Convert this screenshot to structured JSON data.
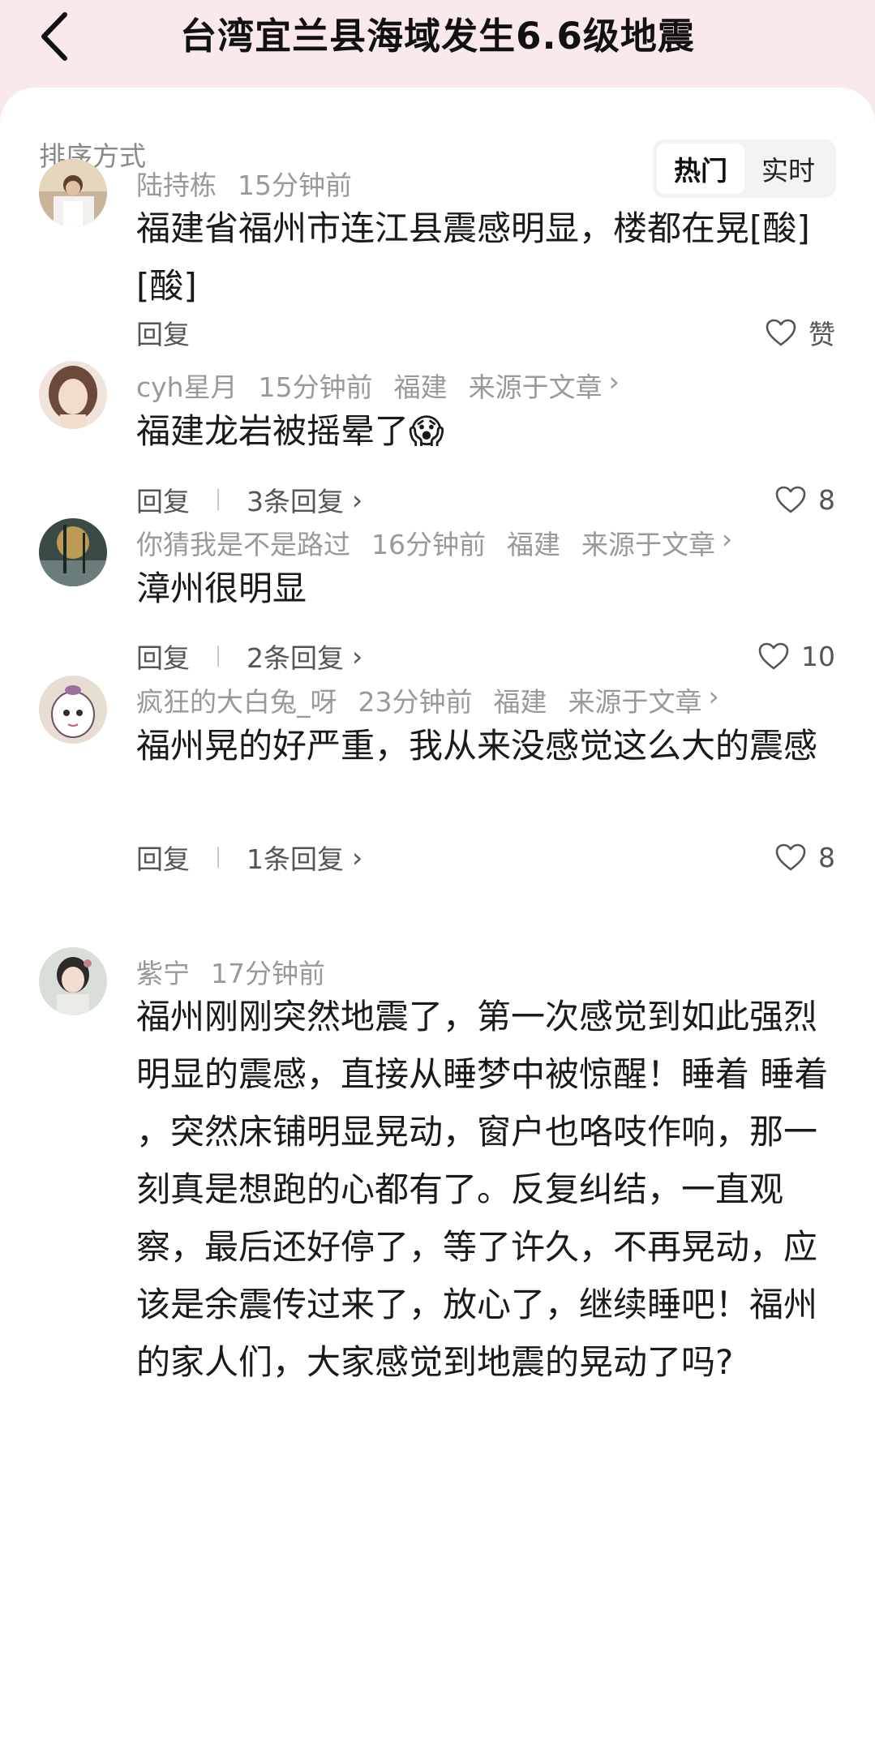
{
  "header": {
    "title": "台湾宜兰县海域发生6.6级地震"
  },
  "sort": {
    "label": "排序方式",
    "options": [
      "热门",
      "实时"
    ],
    "selected": "热门"
  },
  "comments": [
    {
      "user": "陆持栋",
      "time": "15分钟前",
      "location": "",
      "source": "",
      "text": "福建省福州市连江县震感明显，楼都在晃[酸][酸]",
      "reply_label": "回复",
      "reply_count": "",
      "likes": "赞"
    },
    {
      "user": "cyh星月",
      "time": "15分钟前",
      "location": "福建",
      "source": "来源于文章",
      "text": "福建龙岩被摇晕了😱",
      "reply_label": "回复",
      "reply_count": "3条回复",
      "likes": "8"
    },
    {
      "user": "你猜我是不是路过",
      "time": "16分钟前",
      "location": "福建",
      "source": "来源于文章",
      "text": "漳州很明显",
      "reply_label": "回复",
      "reply_count": "2条回复",
      "likes": "10"
    },
    {
      "user": "疯狂的大白兔_呀",
      "time": "23分钟前",
      "location": "福建",
      "source": "来源于文章",
      "text": "福州晃的好严重，我从来没感觉这么大的震感",
      "reply_label": "回复",
      "reply_count": "1条回复",
      "likes": "8"
    },
    {
      "user": "紫宁",
      "time": "17分钟前",
      "location": "",
      "source": "",
      "text": "福州刚刚突然地震了，第一次感觉到如此强烈明显的震感，直接从睡梦中被惊醒！睡着 睡着 ，突然床铺明显晃动，窗户也咯吱作响，那一刻真是想跑的心都有了。反复纠结，一直观察，最后还好停了，等了许久，不再晃动，应该是余震传过来了，放心了，继续睡吧！福州的家人们，大家感觉到地震的晃动了吗?",
      "reply_label": "",
      "reply_count": "",
      "likes": ""
    }
  ]
}
